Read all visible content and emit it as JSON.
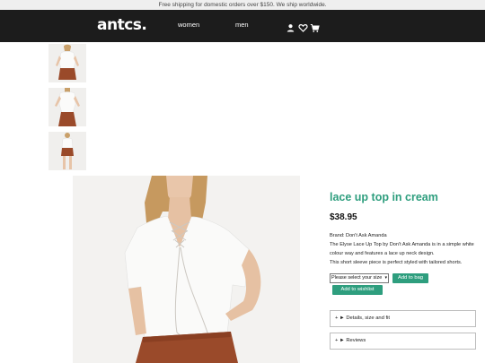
{
  "promo": {
    "text": "Free shipping for domestic orders over $150. We ship worldwide."
  },
  "nav": {
    "logo": "antcs.",
    "links": [
      {
        "label": "women"
      },
      {
        "label": "men"
      }
    ],
    "icons": [
      "user-icon",
      "heart-icon",
      "cart-icon"
    ]
  },
  "gallery": {
    "thumbnails": [
      "thumbnail-1",
      "thumbnail-2",
      "thumbnail-3"
    ]
  },
  "product": {
    "title": "lace up top in cream",
    "price": "$38.95",
    "brand": "Brand: Don't Ask Amanda",
    "description_1": "The Elyse Lace Up Top by Don't Ask Amanda is in a simple white",
    "description_2": "colour way and features a lace up neck design.",
    "description_3": "This short sleeve piece is perfect styled with tailored shorts.",
    "size_select": {
      "selected": "Please select your size"
    },
    "add_to_bag": "Add to bag",
    "add_to_wishlist": "Add to wishlist",
    "accordions": [
      {
        "label": "► Details, size and fit"
      },
      {
        "label": "► Reviews"
      }
    ]
  },
  "colors": {
    "accent": "#2e9e7e",
    "nav_bg": "#1c1c1c",
    "promo_bg": "#efefef",
    "skirt": "#9a4a2a"
  }
}
